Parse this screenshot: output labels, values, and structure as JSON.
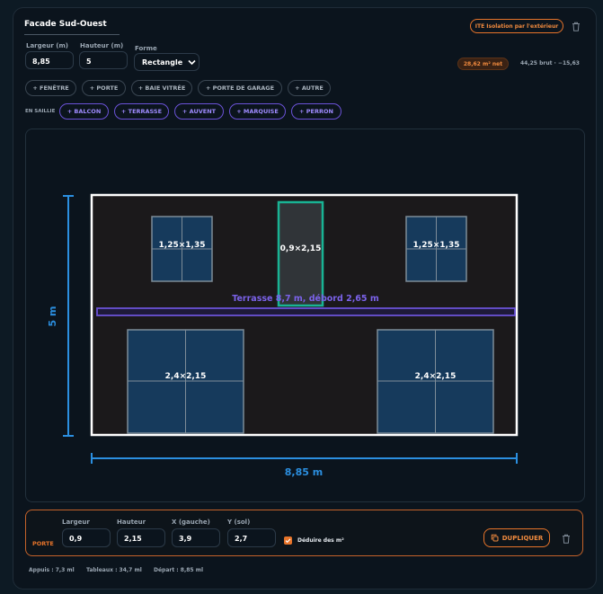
{
  "facade": {
    "title": "Facade Sud-Ouest",
    "ite_button": "ITE Isolation par l'extérieur",
    "width_label": "Largeur (m)",
    "width_value": "8,85",
    "height_label": "Hauteur (m)",
    "height_value": "5",
    "shape_label": "Forme",
    "shape_value": "Rectangle",
    "net_badge": "28,62 m² net",
    "brut_text": "44,25 brut · −15,63"
  },
  "add_buttons": [
    "+ FENÊTRE",
    "+ PORTE",
    "+ BAIE VITRÉE",
    "+ PORTE DE GARAGE",
    "+ AUTRE"
  ],
  "projection": {
    "label": "EN SAILLIE",
    "buttons": [
      "+ BALCON",
      "+ TERRASSE",
      "+ AUVENT",
      "+ MARQUISE",
      "+ PERRON"
    ]
  },
  "drawing": {
    "height_dim": "5 m",
    "width_dim": "8,85 m",
    "openings": {
      "window_left": "1,25×1,35",
      "door": "0,9×2,15",
      "window_right": "1,25×1,35",
      "bay_left": "2,4×2,15",
      "bay_right": "2,4×2,15"
    },
    "terrace_label": "Terrasse 8,7 m, débord 2,65 m"
  },
  "editor": {
    "type": "PORTE",
    "fields": [
      {
        "label": "Largeur",
        "value": "0,9"
      },
      {
        "label": "Hauteur",
        "value": "2,15"
      },
      {
        "label": "X (gauche)",
        "value": "3,9"
      },
      {
        "label": "Y (sol)",
        "value": "2,7"
      }
    ],
    "deduct_label": "Déduire des m²",
    "duplicate_label": "DUPLIQUER"
  },
  "footer": {
    "appuis": "Appuis : 7,3 ml",
    "tableaux": "Tableaux : 34,7 ml",
    "depart": "Départ : 8,85 ml"
  },
  "colors": {
    "accent_orange": "#e7742a",
    "accent_violet": "#6a52d6",
    "dimension_blue": "#2b8fe0",
    "selected_green": "#19b394"
  }
}
